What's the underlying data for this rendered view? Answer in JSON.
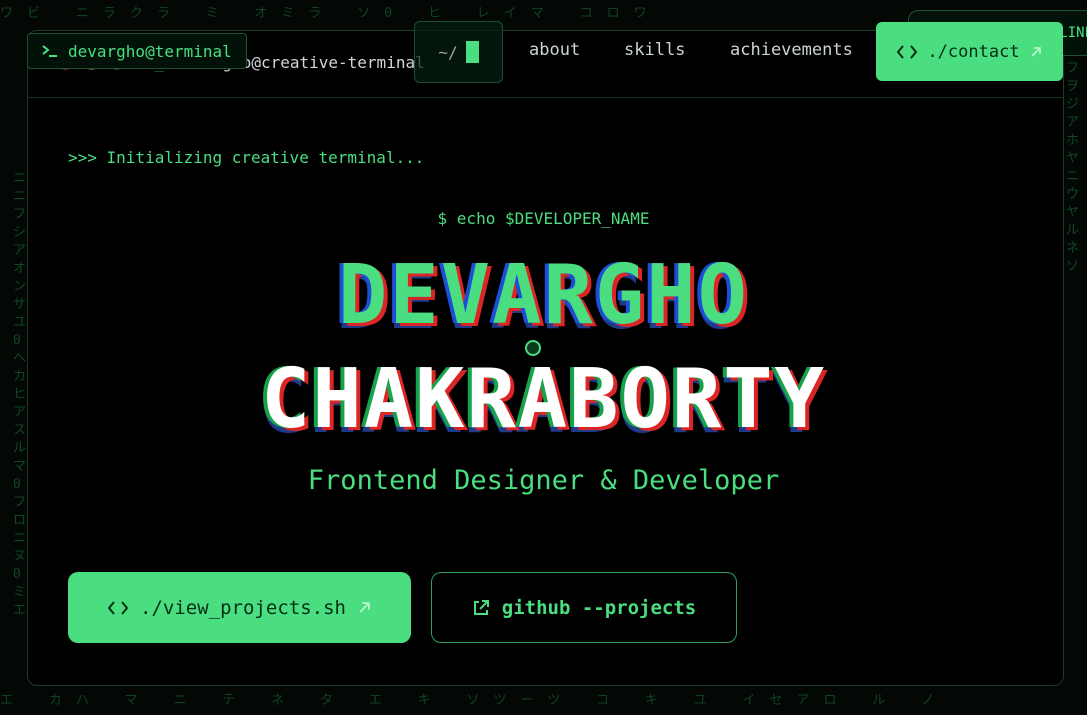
{
  "app": {
    "badge_label": "devargho@terminal",
    "window_title": "devargho@creative-terminal",
    "window_title_prompt": ">_"
  },
  "nav": {
    "cwd": "~/",
    "links": [
      "about",
      "skills",
      "achievements"
    ],
    "contact_label": "./contact",
    "status_pill": "ONLINE"
  },
  "hero": {
    "init_line": ">>> Initializing creative terminal...",
    "echo_command": "$ echo $DEVELOPER_NAME",
    "first_name": "DEVARGHO",
    "last_name": "CHAKRABORTY",
    "role": "Frontend Designer & Developer"
  },
  "actions": {
    "primary_label": "./view_projects.sh",
    "secondary_label": "github --projects"
  },
  "background": {
    "rain_chars": "ワビニラクラミオミラソ0ヒレイマエクラネケイコロワ"
  },
  "colors": {
    "accent": "#4ade80",
    "background": "#000000",
    "accent_dark": "#052e16"
  },
  "icons": [
    "terminal-prompt-icon",
    "code-icon",
    "external-arrow-icon",
    "external-link-icon"
  ]
}
